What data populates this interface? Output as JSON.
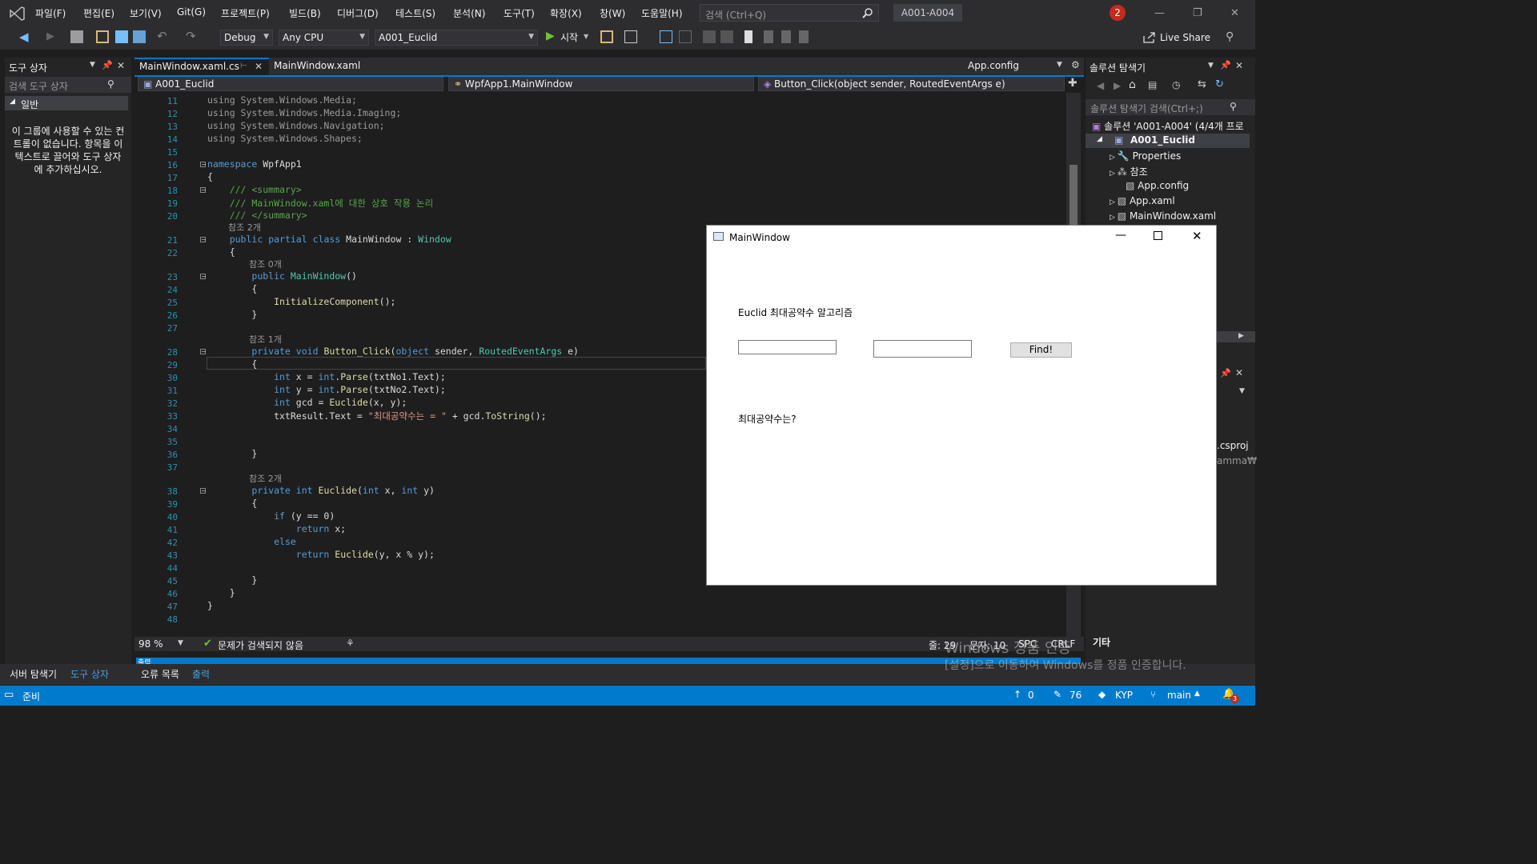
{
  "menu": [
    "파일(F)",
    "편집(E)",
    "보기(V)",
    "Git(G)",
    "프로젝트(P)",
    "빌드(B)",
    "디버그(D)",
    "테스트(S)",
    "분석(N)",
    "도구(T)",
    "확장(X)",
    "창(W)",
    "도움말(H)"
  ],
  "search_placeholder": "검색 (Ctrl+Q)",
  "solution_title": "A001-A004",
  "notif_count": "2",
  "live_share": "Live Share",
  "toolbar": {
    "config": "Debug",
    "platform": "Any CPU",
    "startup": "A001_Euclid",
    "run": "시작"
  },
  "toolbox": {
    "title": "도구 상자",
    "search": "검색 도구 상자",
    "group": "일반",
    "empty_msg": "이 그룹에 사용할 수 있는 컨트롤이 없습니다. 항목을 이 텍스트로 끌어와 도구 상자에 추가하십시오."
  },
  "tabs": {
    "active": "MainWindow.xaml.cs",
    "second": "MainWindow.xaml",
    "right": "App.config"
  },
  "nav": {
    "project": "A001_Euclid",
    "class": "WpfApp1.MainWindow",
    "member": "Button_Click(object sender, RoutedEventArgs e)"
  },
  "code_lines": [
    {
      "n": "11",
      "t": "using System.Windows.Media;",
      "cls": "gr"
    },
    {
      "n": "12",
      "t": "using System.Windows.Media.Imaging;",
      "cls": "gr"
    },
    {
      "n": "13",
      "t": "using System.Windows.Navigation;",
      "cls": "gr"
    },
    {
      "n": "14",
      "t": "using System.Windows.Shapes;",
      "cls": "gr"
    },
    {
      "n": "15",
      "t": "",
      "cls": ""
    },
    {
      "n": "16",
      "t": "namespace WpfApp1",
      "cls": ""
    },
    {
      "n": "17",
      "t": "{",
      "cls": ""
    },
    {
      "n": "18",
      "t": "    /// <summary>",
      "cls": "cm"
    },
    {
      "n": "19",
      "t": "    /// MainWindow.xaml에 대한 상호 작용 논리",
      "cls": "cm"
    },
    {
      "n": "20",
      "t": "    /// </summary>",
      "cls": "cm"
    },
    {
      "n": "21",
      "t": "    public partial class MainWindow : Window",
      "cls": ""
    },
    {
      "n": "22",
      "t": "    {",
      "cls": ""
    },
    {
      "n": "23",
      "t": "        public MainWindow()",
      "cls": ""
    },
    {
      "n": "24",
      "t": "        {",
      "cls": ""
    },
    {
      "n": "25",
      "t": "            InitializeComponent();",
      "cls": ""
    },
    {
      "n": "26",
      "t": "        }",
      "cls": ""
    },
    {
      "n": "27",
      "t": "",
      "cls": ""
    },
    {
      "n": "28",
      "t": "        private void Button_Click(object sender, RoutedEventArgs e)",
      "cls": ""
    },
    {
      "n": "29",
      "t": "        {",
      "cls": ""
    },
    {
      "n": "30",
      "t": "            int x = int.Parse(txtNo1.Text);",
      "cls": ""
    },
    {
      "n": "31",
      "t": "            int y = int.Parse(txtNo2.Text);",
      "cls": ""
    },
    {
      "n": "32",
      "t": "            int gcd = Euclide(x, y);",
      "cls": ""
    },
    {
      "n": "33",
      "t": "            txtResult.Text = \"최대공약수는 = \" + gcd.ToString();",
      "cls": ""
    },
    {
      "n": "34",
      "t": "",
      "cls": ""
    },
    {
      "n": "35",
      "t": "",
      "cls": ""
    },
    {
      "n": "36",
      "t": "        }",
      "cls": ""
    },
    {
      "n": "37",
      "t": "",
      "cls": ""
    },
    {
      "n": "38",
      "t": "        private int Euclide(int x, int y)",
      "cls": ""
    },
    {
      "n": "39",
      "t": "        {",
      "cls": ""
    },
    {
      "n": "40",
      "t": "            if (y == 0)",
      "cls": ""
    },
    {
      "n": "41",
      "t": "                return x;",
      "cls": ""
    },
    {
      "n": "42",
      "t": "            else",
      "cls": ""
    },
    {
      "n": "43",
      "t": "                return Euclide(y, x % y);",
      "cls": ""
    },
    {
      "n": "44",
      "t": "",
      "cls": ""
    },
    {
      "n": "45",
      "t": "        }",
      "cls": ""
    },
    {
      "n": "46",
      "t": "    }",
      "cls": ""
    },
    {
      "n": "47",
      "t": "}",
      "cls": ""
    },
    {
      "n": "48",
      "t": "",
      "cls": ""
    }
  ],
  "codelens": {
    "class_refs": "참조 2개",
    "ctor_refs": "참조 0개",
    "click_refs": "참조 1개",
    "euclide_refs": "참조 2개"
  },
  "editor_status": {
    "zoom": "98 %",
    "issues": "문제가 검색되지 않음",
    "line": "줄: 29",
    "col": "문자: 10",
    "spc": "SPC",
    "crlf": "CRLF"
  },
  "solution": {
    "title": "솔루션 탐색기",
    "search": "솔루션 탐색기 검색(Ctrl+;)",
    "root": "솔루션 'A001-A004' (4/4개 프로",
    "project": "A001_Euclid",
    "items": [
      "Properties",
      "참조",
      "App.config",
      "App.xaml",
      "MainWindow.xaml"
    ],
    "partial1": ".csproj",
    "partial2": "amma₩",
    "misc": "기타"
  },
  "bottom_tabs": [
    "서버 탐색기",
    "도구 상자"
  ],
  "output_tabs": [
    "오류 목록",
    "출력"
  ],
  "output_label": "출력",
  "status": {
    "ready": "준비",
    "up": "0",
    "edits": "76",
    "repo": "KYP",
    "branch": "main",
    "bell": "3"
  },
  "watermark": {
    "line1": "Windows 정품 인증",
    "line2": "[설정]으로 이동하여 Windows를 정품 인증합니다."
  },
  "mainwindow": {
    "title": "MainWindow",
    "heading": "Euclid 최대공약수 알고리즘",
    "button": "Find!",
    "result": "최대공약수는?"
  }
}
